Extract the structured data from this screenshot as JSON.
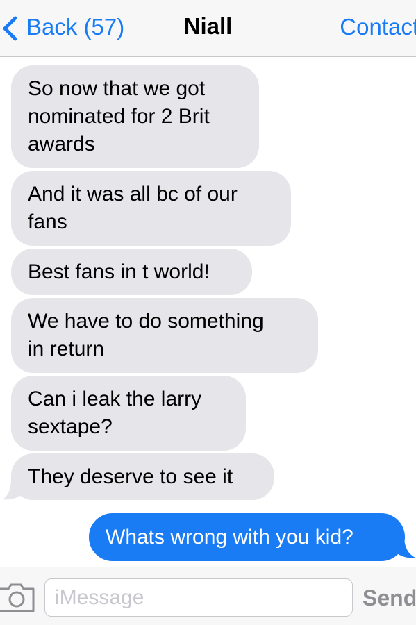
{
  "navbar": {
    "back_label": "Back (57)",
    "title": "Niall",
    "subtitle": "",
    "contact_label": "Contact"
  },
  "messages": [
    {
      "direction": "incoming",
      "text": "So now that we got\nnominated for 2 Brit\nawards"
    },
    {
      "direction": "incoming",
      "text": "And it was all bc of our\nfans"
    },
    {
      "direction": "incoming",
      "text": "Best fans in t world!"
    },
    {
      "direction": "incoming",
      "text": "We have to do something\nin return"
    },
    {
      "direction": "incoming",
      "text": "Can i leak the larry\nsextape?"
    },
    {
      "direction": "incoming",
      "text": "They deserve to see it"
    },
    {
      "direction": "outgoing",
      "text": "Whats wrong with you kid?"
    }
  ],
  "read_receipt": "",
  "input_bar": {
    "placeholder": "iMessage",
    "value": "",
    "send_label": "Send"
  },
  "icons": {
    "back": "chevron-left-icon",
    "camera": "camera-icon"
  },
  "colors": {
    "accent": "#1a7cf5",
    "incoming_bubble": "#e5e5ea",
    "outgoing_bubble": "#1a7cf5",
    "bar_background": "#f7f7f8"
  }
}
